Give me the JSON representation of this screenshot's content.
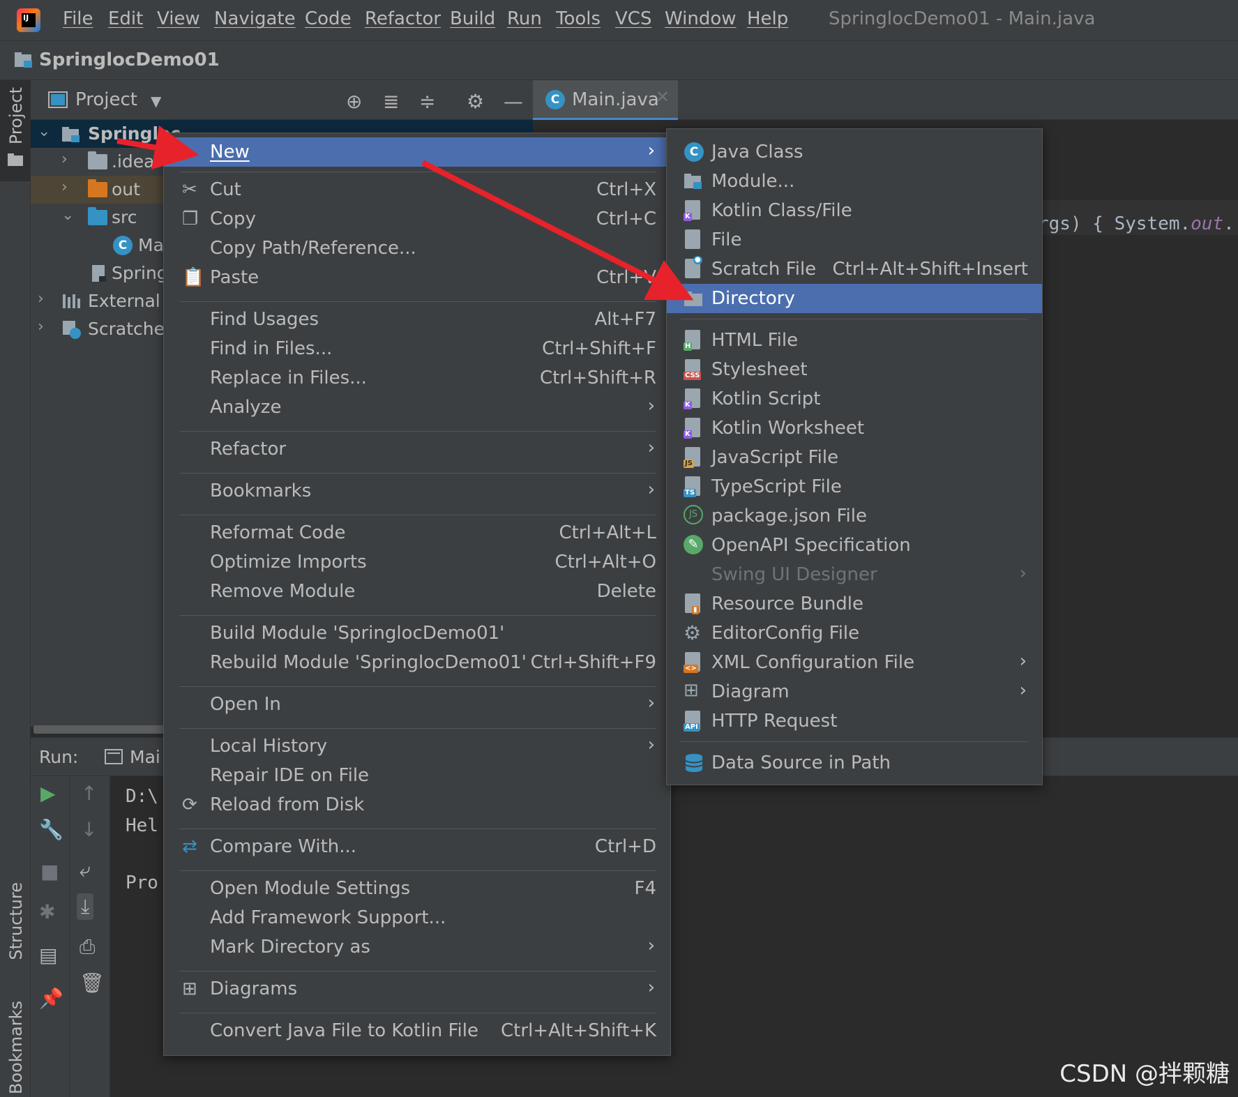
{
  "menubar": {
    "items": [
      "File",
      "Edit",
      "View",
      "Navigate",
      "Code",
      "Refactor",
      "Build",
      "Run",
      "Tools",
      "VCS",
      "Window",
      "Help"
    ],
    "window_title": "SpringlocDemo01 - Main.java"
  },
  "navbar": {
    "project": "SpringlocDemo01"
  },
  "left_strip": {
    "project": "Project",
    "structure": "Structure",
    "bookmarks": "Bookmarks"
  },
  "project_panel": {
    "title": "Project",
    "tree": {
      "root": "Springloc",
      "idea": ".idea",
      "out": "out",
      "src": "src",
      "main": "Ma",
      "iml": "Spring",
      "external": "External L",
      "scratches": "Scratches"
    }
  },
  "editor": {
    "tab": "Main.java",
    "tab_close": "✕",
    "code": {
      "pre": "rgs) { System.",
      "ital": "out",
      "post": "."
    }
  },
  "run": {
    "label": "Run:",
    "tab": "Mai",
    "lines": [
      "D:\\",
      "Hel",
      "Pro"
    ]
  },
  "context_menu": {
    "new": "New",
    "cut": {
      "label": "Cut",
      "shortcut": "Ctrl+X"
    },
    "copy": {
      "label": "Copy",
      "shortcut": "Ctrl+C"
    },
    "copy_path": "Copy Path/Reference...",
    "paste": {
      "label": "Paste",
      "shortcut": "Ctrl+V"
    },
    "find_usages": {
      "label": "Find Usages",
      "shortcut": "Alt+F7"
    },
    "find_in_files": {
      "label": "Find in Files...",
      "shortcut": "Ctrl+Shift+F"
    },
    "replace_in_files": {
      "label": "Replace in Files...",
      "shortcut": "Ctrl+Shift+R"
    },
    "analyze": "Analyze",
    "refactor": "Refactor",
    "bookmarks": "Bookmarks",
    "reformat": {
      "label": "Reformat Code",
      "shortcut": "Ctrl+Alt+L"
    },
    "optimize": {
      "label": "Optimize Imports",
      "shortcut": "Ctrl+Alt+O"
    },
    "remove_module": {
      "label": "Remove Module",
      "shortcut": "Delete"
    },
    "build_module": "Build Module 'SpringlocDemo01'",
    "rebuild_module": {
      "label": "Rebuild Module 'SpringlocDemo01'",
      "shortcut": "Ctrl+Shift+F9"
    },
    "open_in": "Open In",
    "local_history": "Local History",
    "repair_ide": "Repair IDE on File",
    "reload": "Reload from Disk",
    "compare": {
      "label": "Compare With...",
      "shortcut": "Ctrl+D"
    },
    "module_settings": {
      "label": "Open Module Settings",
      "shortcut": "F4"
    },
    "framework": "Add Framework Support...",
    "mark_dir": "Mark Directory as",
    "diagrams": "Diagrams",
    "convert": {
      "label": "Convert Java File to Kotlin File",
      "shortcut": "Ctrl+Alt+Shift+K"
    }
  },
  "new_submenu": {
    "java_class": "Java Class",
    "module": "Module...",
    "kotlin_class": "Kotlin Class/File",
    "file": "File",
    "scratch": {
      "label": "Scratch File",
      "shortcut": "Ctrl+Alt+Shift+Insert"
    },
    "directory": "Directory",
    "html": "HTML File",
    "stylesheet": "Stylesheet",
    "kotlin_script": "Kotlin Script",
    "kotlin_worksheet": "Kotlin Worksheet",
    "javascript": "JavaScript File",
    "typescript": "TypeScript File",
    "package_json": "package.json File",
    "openapi": "OpenAPI Specification",
    "swing": "Swing UI Designer",
    "resource_bundle": "Resource Bundle",
    "editorconfig": "EditorConfig File",
    "xml_config": "XML Configuration File",
    "diagram": "Diagram",
    "http": "HTTP Request",
    "datasource": "Data Source in Path"
  },
  "watermark": "CSDN @拌颗糖",
  "colors": {
    "selection": "#4b6eaf",
    "menu_bg": "#3c3f41",
    "editor_bg": "#2b2b2b",
    "annotation_arrow": "#e8222a"
  }
}
